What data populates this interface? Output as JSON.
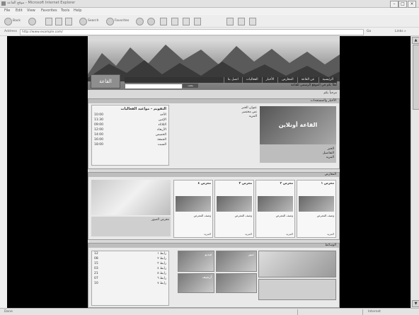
{
  "window": {
    "title": "موقع القاعة - Microsoft Internet Explorer",
    "min": "–",
    "max": "□",
    "close": "×"
  },
  "menu": [
    "File",
    "Edit",
    "View",
    "Favorites",
    "Tools",
    "Help"
  ],
  "toolbar": {
    "back": "Back",
    "search": "Search",
    "favorites": "Favorites"
  },
  "address": {
    "label": "Address",
    "url": "http://www.example.com/",
    "go": "Go",
    "links": "Links »"
  },
  "site": {
    "logo": "القاعة",
    "nav": [
      "الرئيسية",
      "عن القاعة",
      "المعارض",
      "الأخبار",
      "الفعاليات",
      "اتصل بنا"
    ],
    "notice": "أهلاً بكم في الموقع الرسمي للقاعة",
    "search_button": "بحث",
    "slogan": "مرحباً بكم"
  },
  "panel1": {
    "header": "الأخبار والمستجدات",
    "feature_title": "القاعة أونلاين",
    "feature_caption": [
      "الخبر",
      "التفاصيل",
      "المزيد"
    ],
    "mid_text": [
      "عنوان الخبر",
      "نص مختصر",
      "المزيد"
    ],
    "schedule_title": "التقويم - مواعيد الفعاليات",
    "schedule": [
      {
        "day": "الأحد",
        "time": "10:00"
      },
      {
        "day": "الإثنين",
        "time": "11:30"
      },
      {
        "day": "الثلاثاء",
        "time": "09:00"
      },
      {
        "day": "الأربعاء",
        "time": "12:00"
      },
      {
        "day": "الخميس",
        "time": "14:00"
      },
      {
        "day": "الجمعة",
        "time": "16:00"
      },
      {
        "day": "السبت",
        "time": "18:00"
      }
    ]
  },
  "panel2": {
    "header": "المعارض",
    "banner_caption": "معرض الصور",
    "cards": [
      {
        "title": "معرض ١",
        "desc": "وصف المعرض",
        "more": "المزيد"
      },
      {
        "title": "معرض ٢",
        "desc": "وصف المعرض",
        "more": "المزيد"
      },
      {
        "title": "معرض ٣",
        "desc": "وصف المعرض",
        "more": "المزيد"
      },
      {
        "title": "معرض ٤",
        "desc": "وصف المعرض",
        "more": "المزيد"
      }
    ]
  },
  "panel3": {
    "header": "الوسائط",
    "labels": [
      "صور",
      "فيديو",
      "أرشيف"
    ],
    "list": [
      {
        "name": "رابط ١",
        "count": "12"
      },
      {
        "name": "رابط ٢",
        "count": "08"
      },
      {
        "name": "رابط ٣",
        "count": "15"
      },
      {
        "name": "رابط ٤",
        "count": "03"
      },
      {
        "name": "رابط ٥",
        "count": "21"
      },
      {
        "name": "رابط ٦",
        "count": "07"
      },
      {
        "name": "رابط ٧",
        "count": "10"
      }
    ]
  },
  "status": {
    "text": "Done",
    "zone": "Internet"
  }
}
